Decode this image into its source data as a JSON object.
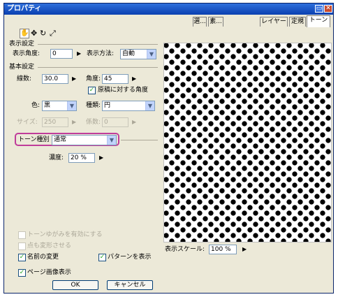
{
  "window": {
    "title": "プロパティ"
  },
  "titlebar_buttons": {
    "restore": "▭",
    "close": "✕"
  },
  "tabs": [
    {
      "label": "選..."
    },
    {
      "label": "素..."
    },
    {
      "label": "レイヤー"
    },
    {
      "label": "定規"
    },
    {
      "label": "トーン"
    }
  ],
  "toolbar": {
    "icons": [
      "hand-icon",
      "move-icon",
      "rotate-icon",
      "scale-icon"
    ]
  },
  "display": {
    "section_label": "表示設定",
    "angle_label": "表示角度:",
    "angle_value": "0",
    "method_label": "表示方法:",
    "method_value": "自動"
  },
  "basic": {
    "section_label": "基本設定",
    "lines_label": "線数:",
    "lines_value": "30.0",
    "angle_label": "角度:",
    "angle_value": "45",
    "relative_angle_label": "原稿に対する角度",
    "color_label": "色:",
    "color_value": "黒",
    "type_label": "種類:",
    "type_value": "円",
    "size_label": "サイズ:",
    "size_value": "250",
    "coef_label": "係数:",
    "coef_value": "0"
  },
  "tone_type": {
    "label": "トーン種別",
    "value": "通常"
  },
  "density": {
    "label": "濃度:",
    "value": "20 %"
  },
  "options": {
    "distortion_label": "トーンゆがみを有効にする",
    "dot_deform_label": "点も変形させる",
    "name_change_label": "名前の変更",
    "show_pattern_label": "パターンを表示",
    "page_image_label": "ページ画像表示"
  },
  "scale": {
    "label": "表示スケール:",
    "value": "100 %"
  },
  "buttons": {
    "ok": "OK",
    "cancel": "キャンセル"
  },
  "glyphs": {
    "right_arrow": "▶",
    "dropdown": "▼",
    "check": "✓"
  }
}
